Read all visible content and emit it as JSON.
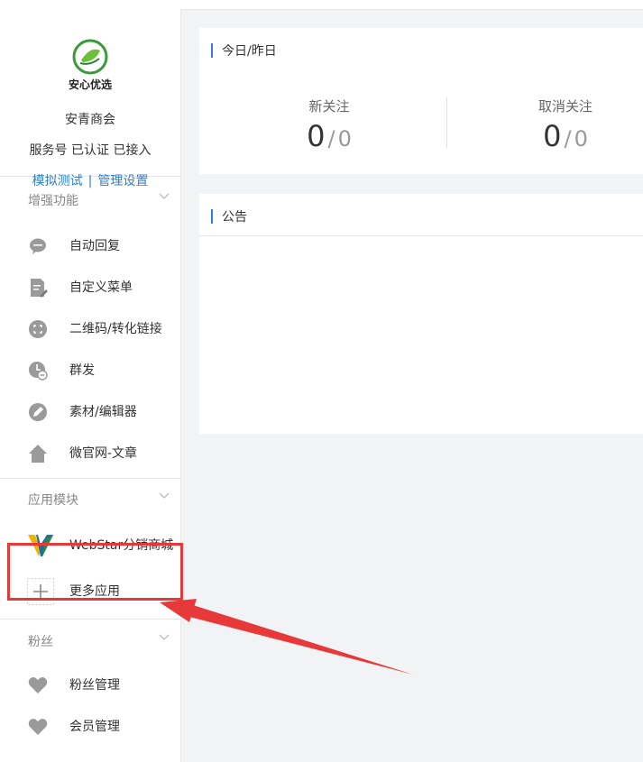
{
  "account": {
    "logo_text": "安心优选",
    "name": "安青商会",
    "status": "服务号 已认证 已接入",
    "link_test": "模拟测试",
    "link_separator": "|",
    "link_settings": "管理设置"
  },
  "sections": {
    "enhance": {
      "title": "增强功能",
      "items": [
        {
          "label": "自动回复",
          "icon": "chat-bubble-icon"
        },
        {
          "label": "自定义菜单",
          "icon": "document-edit-icon"
        },
        {
          "label": "二维码/转化链接",
          "icon": "qrcode-icon"
        },
        {
          "label": "群发",
          "icon": "clock-send-icon"
        },
        {
          "label": "素材/编辑器",
          "icon": "pencil-icon"
        },
        {
          "label": "微官网-文章",
          "icon": "home-icon"
        }
      ]
    },
    "apps": {
      "title": "应用模块",
      "items": [
        {
          "label": "WebStar分销商城",
          "icon": "webstar-logo-icon"
        },
        {
          "label": "更多应用",
          "icon": "plus-icon"
        }
      ]
    },
    "fans": {
      "title": "粉丝",
      "items": [
        {
          "label": "粉丝管理",
          "icon": "heart-icon"
        },
        {
          "label": "会员管理",
          "icon": "heart-icon"
        }
      ]
    }
  },
  "stats_card": {
    "title": "今日/昨日",
    "new_follow": {
      "label": "新关注",
      "today": "0",
      "separator": "/",
      "yesterday": "0"
    },
    "unfollow": {
      "label": "取消关注",
      "today": "0",
      "separator": "/",
      "yesterday": "0"
    }
  },
  "notice_card": {
    "title": "公告"
  },
  "colors": {
    "accent": "#2f7fd4",
    "highlight": "#e8393a",
    "icon_gray": "#9a9a9a"
  }
}
